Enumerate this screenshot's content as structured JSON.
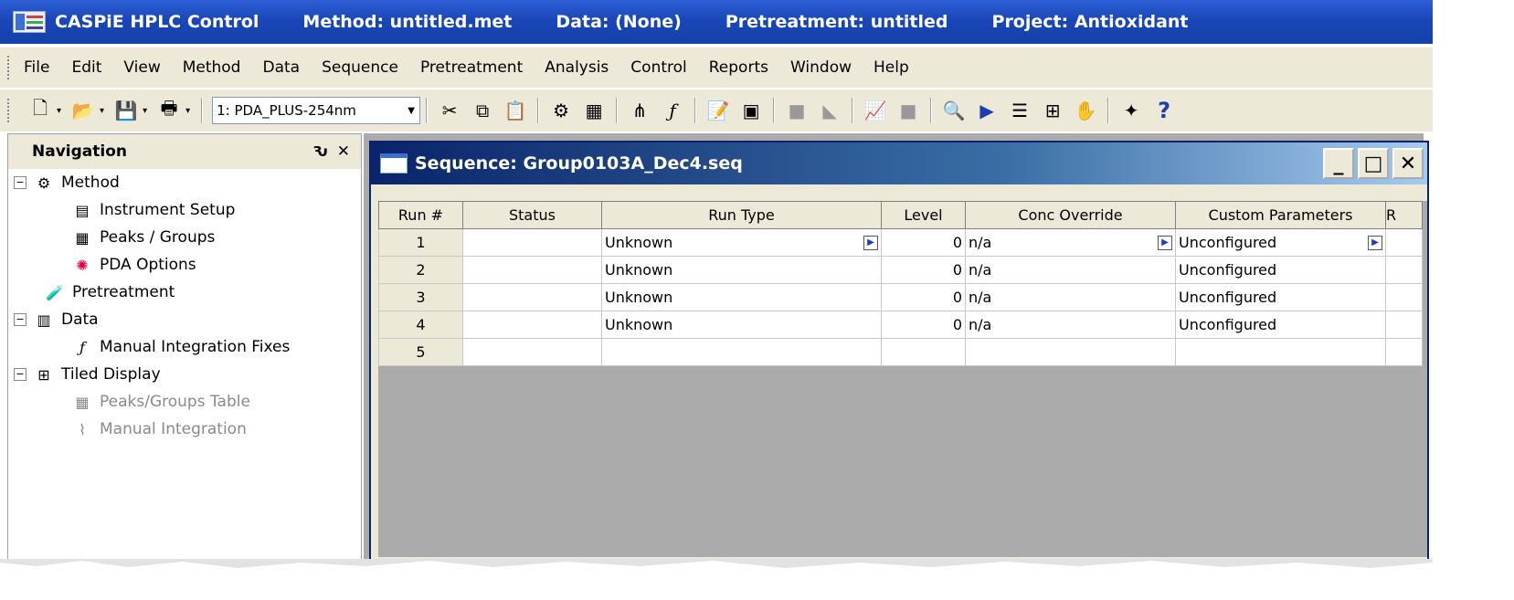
{
  "titlebar": {
    "app": "CASPiE HPLC Control",
    "method": "Method: untitled.met",
    "data": "Data: (None)",
    "pretreatment": "Pretreatment: untitled",
    "project": "Project: Antioxidant"
  },
  "menu": [
    "File",
    "Edit",
    "View",
    "Method",
    "Data",
    "Sequence",
    "Pretreatment",
    "Analysis",
    "Control",
    "Reports",
    "Window",
    "Help"
  ],
  "toolbar": {
    "channel_value": "1: PDA_PLUS-254nm",
    "help_glyph": "?"
  },
  "navigation": {
    "title": "Navigation",
    "pin_glyph": "Ԅ",
    "close_glyph": "✕",
    "items": [
      {
        "label": "Method"
      },
      {
        "label": "Instrument Setup"
      },
      {
        "label": "Peaks / Groups"
      },
      {
        "label": "PDA Options"
      },
      {
        "label": "Pretreatment"
      },
      {
        "label": "Data"
      },
      {
        "label": "Manual Integration Fixes"
      },
      {
        "label": "Tiled Display"
      },
      {
        "label": "Peaks/Groups Table"
      },
      {
        "label": "Manual Integration"
      }
    ]
  },
  "sequence_window": {
    "title": "Sequence: Group0103A_Dec4.seq",
    "minimize": "_",
    "maximize": "□",
    "close": "✕",
    "columns": [
      "Run #",
      "Status",
      "Run Type",
      "Level",
      "Conc Override",
      "Custom Parameters",
      "R"
    ],
    "rows": [
      {
        "run": "1",
        "status": "",
        "run_type": "Unknown",
        "level": "0",
        "conc": "n/a",
        "custom": "Unconfigured"
      },
      {
        "run": "2",
        "status": "",
        "run_type": "Unknown",
        "level": "0",
        "conc": "n/a",
        "custom": "Unconfigured"
      },
      {
        "run": "3",
        "status": "",
        "run_type": "Unknown",
        "level": "0",
        "conc": "n/a",
        "custom": "Unconfigured"
      },
      {
        "run": "4",
        "status": "",
        "run_type": "Unknown",
        "level": "0",
        "conc": "n/a",
        "custom": "Unconfigured"
      },
      {
        "run": "5",
        "status": "",
        "run_type": "",
        "level": "",
        "conc": "",
        "custom": ""
      }
    ]
  },
  "colors": {
    "titlebar": "#1a47b8",
    "chrome": "#ece9d8",
    "mdi_background": "#ababab",
    "window_title_start": "#0a246a",
    "dropdown_arrow": "#1a3ec8"
  }
}
